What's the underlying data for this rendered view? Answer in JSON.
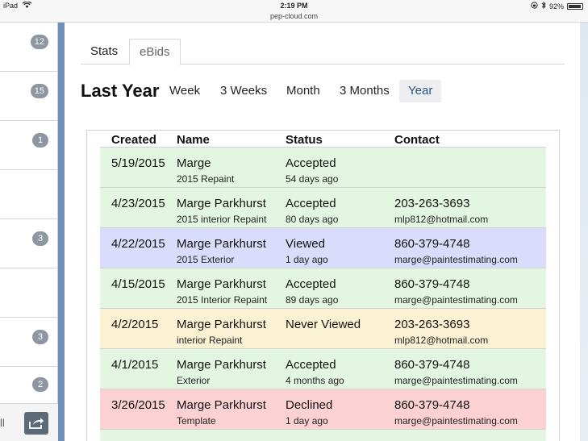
{
  "status_bar": {
    "device": "iPad",
    "time": "2:19 PM",
    "url": "pep-cloud.com",
    "battery": "92%",
    "battery_level": 0.92
  },
  "sidebar": {
    "badges": [
      "12",
      "15",
      "1",
      "3",
      "3",
      "2"
    ],
    "bottom_text": "ll"
  },
  "tabs": [
    {
      "label": "Stats"
    },
    {
      "label": "eBids"
    }
  ],
  "period": {
    "title": "Last Year",
    "options": [
      "Week",
      "3 Weeks",
      "Month",
      "3 Months",
      "Year"
    ],
    "selected": "Year"
  },
  "table": {
    "headers": [
      "Created",
      "Name",
      "Status",
      "Contact"
    ],
    "rows": [
      {
        "created": "5/19/2015",
        "name": "Marge",
        "project": "2015 Repaint",
        "status": "Accepted",
        "when": "54 days ago",
        "phone": "",
        "email": "",
        "color": "#e3f6e1"
      },
      {
        "created": "4/23/2015",
        "name": "Marge Parkhurst",
        "project": "2015 interior Repaint",
        "status": "Accepted",
        "when": "80 days ago",
        "phone": "203-263-3693",
        "email": "mlp812@hotmail.com",
        "color": "#e3f6e1"
      },
      {
        "created": "4/22/2015",
        "name": "Marge Parkhurst",
        "project": "2015 Exterior",
        "status": "Viewed",
        "when": "1 day ago",
        "phone": "860-379-4748",
        "email": "marge@paintestimating.com",
        "color": "#d9dcfa"
      },
      {
        "created": "4/15/2015",
        "name": "Marge Parkhurst",
        "project": "2015 Interior Repaint",
        "status": "Accepted",
        "when": "89 days ago",
        "phone": "860-379-4748",
        "email": "marge@paintestimating.com",
        "color": "#e3f6e1"
      },
      {
        "created": "4/2/2015",
        "name": "Marge Parkhurst",
        "project": "interior Repaint",
        "status": "Never Viewed",
        "when": "",
        "phone": "203-263-3693",
        "email": "mlp812@hotmail.com",
        "color": "#fbf1d3"
      },
      {
        "created": "4/1/2015",
        "name": "Marge Parkhurst",
        "project": "Exterior",
        "status": "Accepted",
        "when": "4 months ago",
        "phone": "860-379-4748",
        "email": "marge@paintestimating.com",
        "color": "#e3f6e1"
      },
      {
        "created": "3/26/2015",
        "name": "Marge Parkhurst",
        "project": "Template",
        "status": "Declined",
        "when": "1 day ago",
        "phone": "860-379-4748",
        "email": "marge@paintestimating.com",
        "color": "#fbd1d4"
      }
    ]
  }
}
